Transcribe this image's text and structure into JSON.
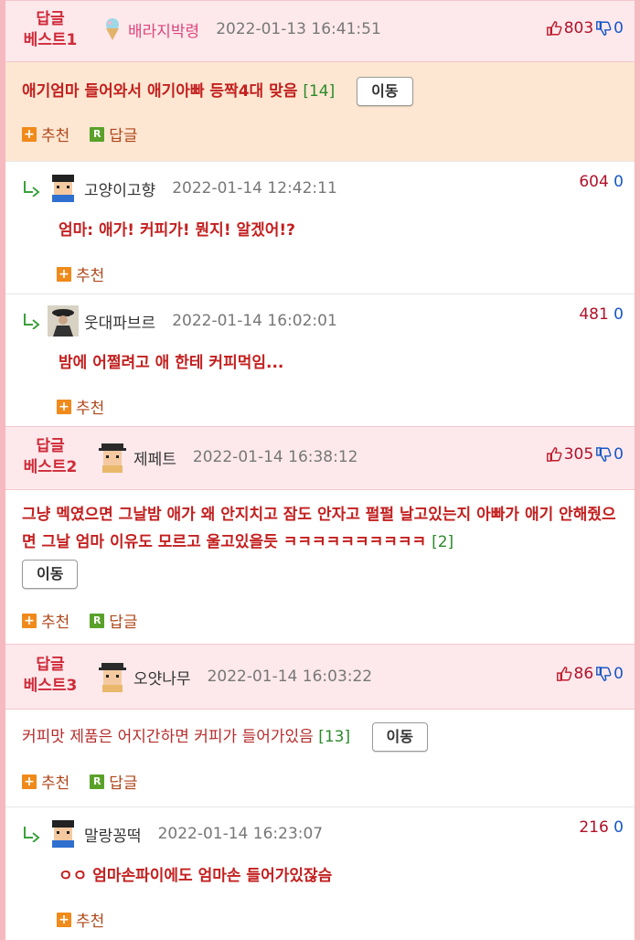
{
  "best1": {
    "label_line1": "답글",
    "label_line2": "베스트1",
    "user": "배라지박령",
    "timestamp": "2022-01-13 16:41:51",
    "up": "803",
    "down": "0",
    "text": "애기엄마 들어와서 애기아빠 등짝4대 맞음",
    "count": "[14]",
    "move": "이동",
    "recommend": "추천",
    "reply": "답글",
    "replies": [
      {
        "user": "고양이고향",
        "timestamp": "2022-01-14 12:42:11",
        "up": "604",
        "down": "0",
        "text": "엄마: 애가! 커피가! 뭔지! 알겠어!?",
        "recommend": "추천"
      },
      {
        "user": "웃대파브르",
        "timestamp": "2022-01-14 16:02:01",
        "up": "481",
        "down": "0",
        "text": "밤에 어쩔려고 애 한테 커피먹임...",
        "recommend": "추천"
      }
    ]
  },
  "best2": {
    "label_line1": "답글",
    "label_line2": "베스트2",
    "user": "제페트",
    "timestamp": "2022-01-14 16:38:12",
    "up": "305",
    "down": "0",
    "text": "그냥 멕였으면 그날밤 애가 왜 안지치고 잠도 안자고 펄펄 날고있는지 아빠가 애기 안해줬으면 그날 엄마 이유도 모르고 울고있을듯 ㅋㅋㅋㅋㅋㅋㅋㅋㅋㅋ",
    "count": "[2]",
    "move": "이동",
    "recommend": "추천",
    "reply": "답글"
  },
  "best3": {
    "label_line1": "답글",
    "label_line2": "베스트3",
    "user": "오얏나무",
    "timestamp": "2022-01-14 16:03:22",
    "up": "86",
    "down": "0",
    "text": "커피맛 제품은 어지간하면 커피가 들어가있음",
    "count": "[13]",
    "move": "이동",
    "recommend": "추천",
    "reply": "답글",
    "replies": [
      {
        "user": "말랑꽁떡",
        "timestamp": "2022-01-14 16:23:07",
        "up": "216",
        "down": "0",
        "text": "ㅇㅇ 엄마손파이에도 엄마손 들어가있잖슴",
        "recommend": "추천"
      }
    ]
  },
  "colors": {
    "accent_red": "#c3201f",
    "pink_border": "#f6b9bf",
    "best_bg": "#fde9ec",
    "highlight_bg": "#fde7d2",
    "down_blue": "#1757c7"
  }
}
